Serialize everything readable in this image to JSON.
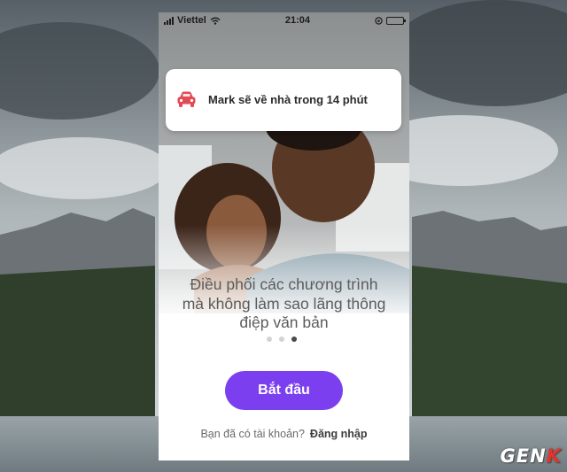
{
  "status_bar": {
    "carrier": "Viettel",
    "time": "21:04"
  },
  "notification": {
    "icon": "car-icon",
    "message": "Mark sẽ về nhà trong 14 phút"
  },
  "onboarding": {
    "headline": "Điều phối các chương trình\nmà không làm sao lãng thông\nđiệp văn bản",
    "page_indicator": {
      "total": 3,
      "active": 3
    },
    "start_button": "Bắt đầu",
    "account_prompt": "Bạn đã có tài khoản?",
    "login_link": "Đăng nhập"
  },
  "watermark": {
    "left": "GEN",
    "right": "K"
  },
  "colors": {
    "accent": "#7b3ff0",
    "car_icon": "#e24a55",
    "watermark_accent": "#e5322d"
  }
}
